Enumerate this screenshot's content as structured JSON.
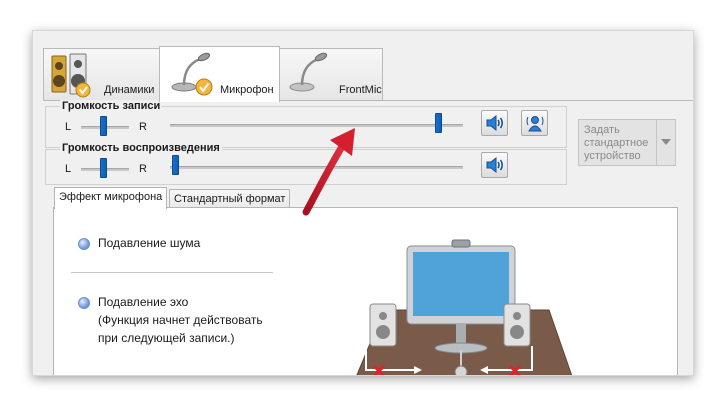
{
  "device_tabs": [
    {
      "label": "Динамики",
      "icon": "speakers-icon",
      "active": false
    },
    {
      "label": "Микрофон",
      "icon": "microphone-icon",
      "active": true
    },
    {
      "label": "FrontMic",
      "icon": "microphone-icon",
      "active": false
    }
  ],
  "record_volume": {
    "title": "Громкость записи",
    "left_label": "L",
    "right_label": "R",
    "balance": 0.5,
    "level": 0.93
  },
  "playback_volume": {
    "title": "Громкость воспроизведения",
    "left_label": "L",
    "right_label": "R",
    "balance": 0.5,
    "level": 0.0
  },
  "default_device_button": {
    "label": "Задать стандартное устройство",
    "enabled": false
  },
  "inner_tabs": [
    {
      "label": "Эффект микрофона",
      "active": true
    },
    {
      "label": "Стандартный формат",
      "active": false
    }
  ],
  "effects": {
    "noise_suppression": "Подавление шума",
    "echo_cancellation": "Подавление эхо",
    "echo_note_line1": "(Функция начнет действовать",
    "echo_note_line2": "при следующей записи.)"
  },
  "colors": {
    "accent": "#0f5fb8",
    "annotation_arrow": "#c8102e",
    "desk": "#7a5a48",
    "monitor_screen": "#4fa3d9"
  }
}
